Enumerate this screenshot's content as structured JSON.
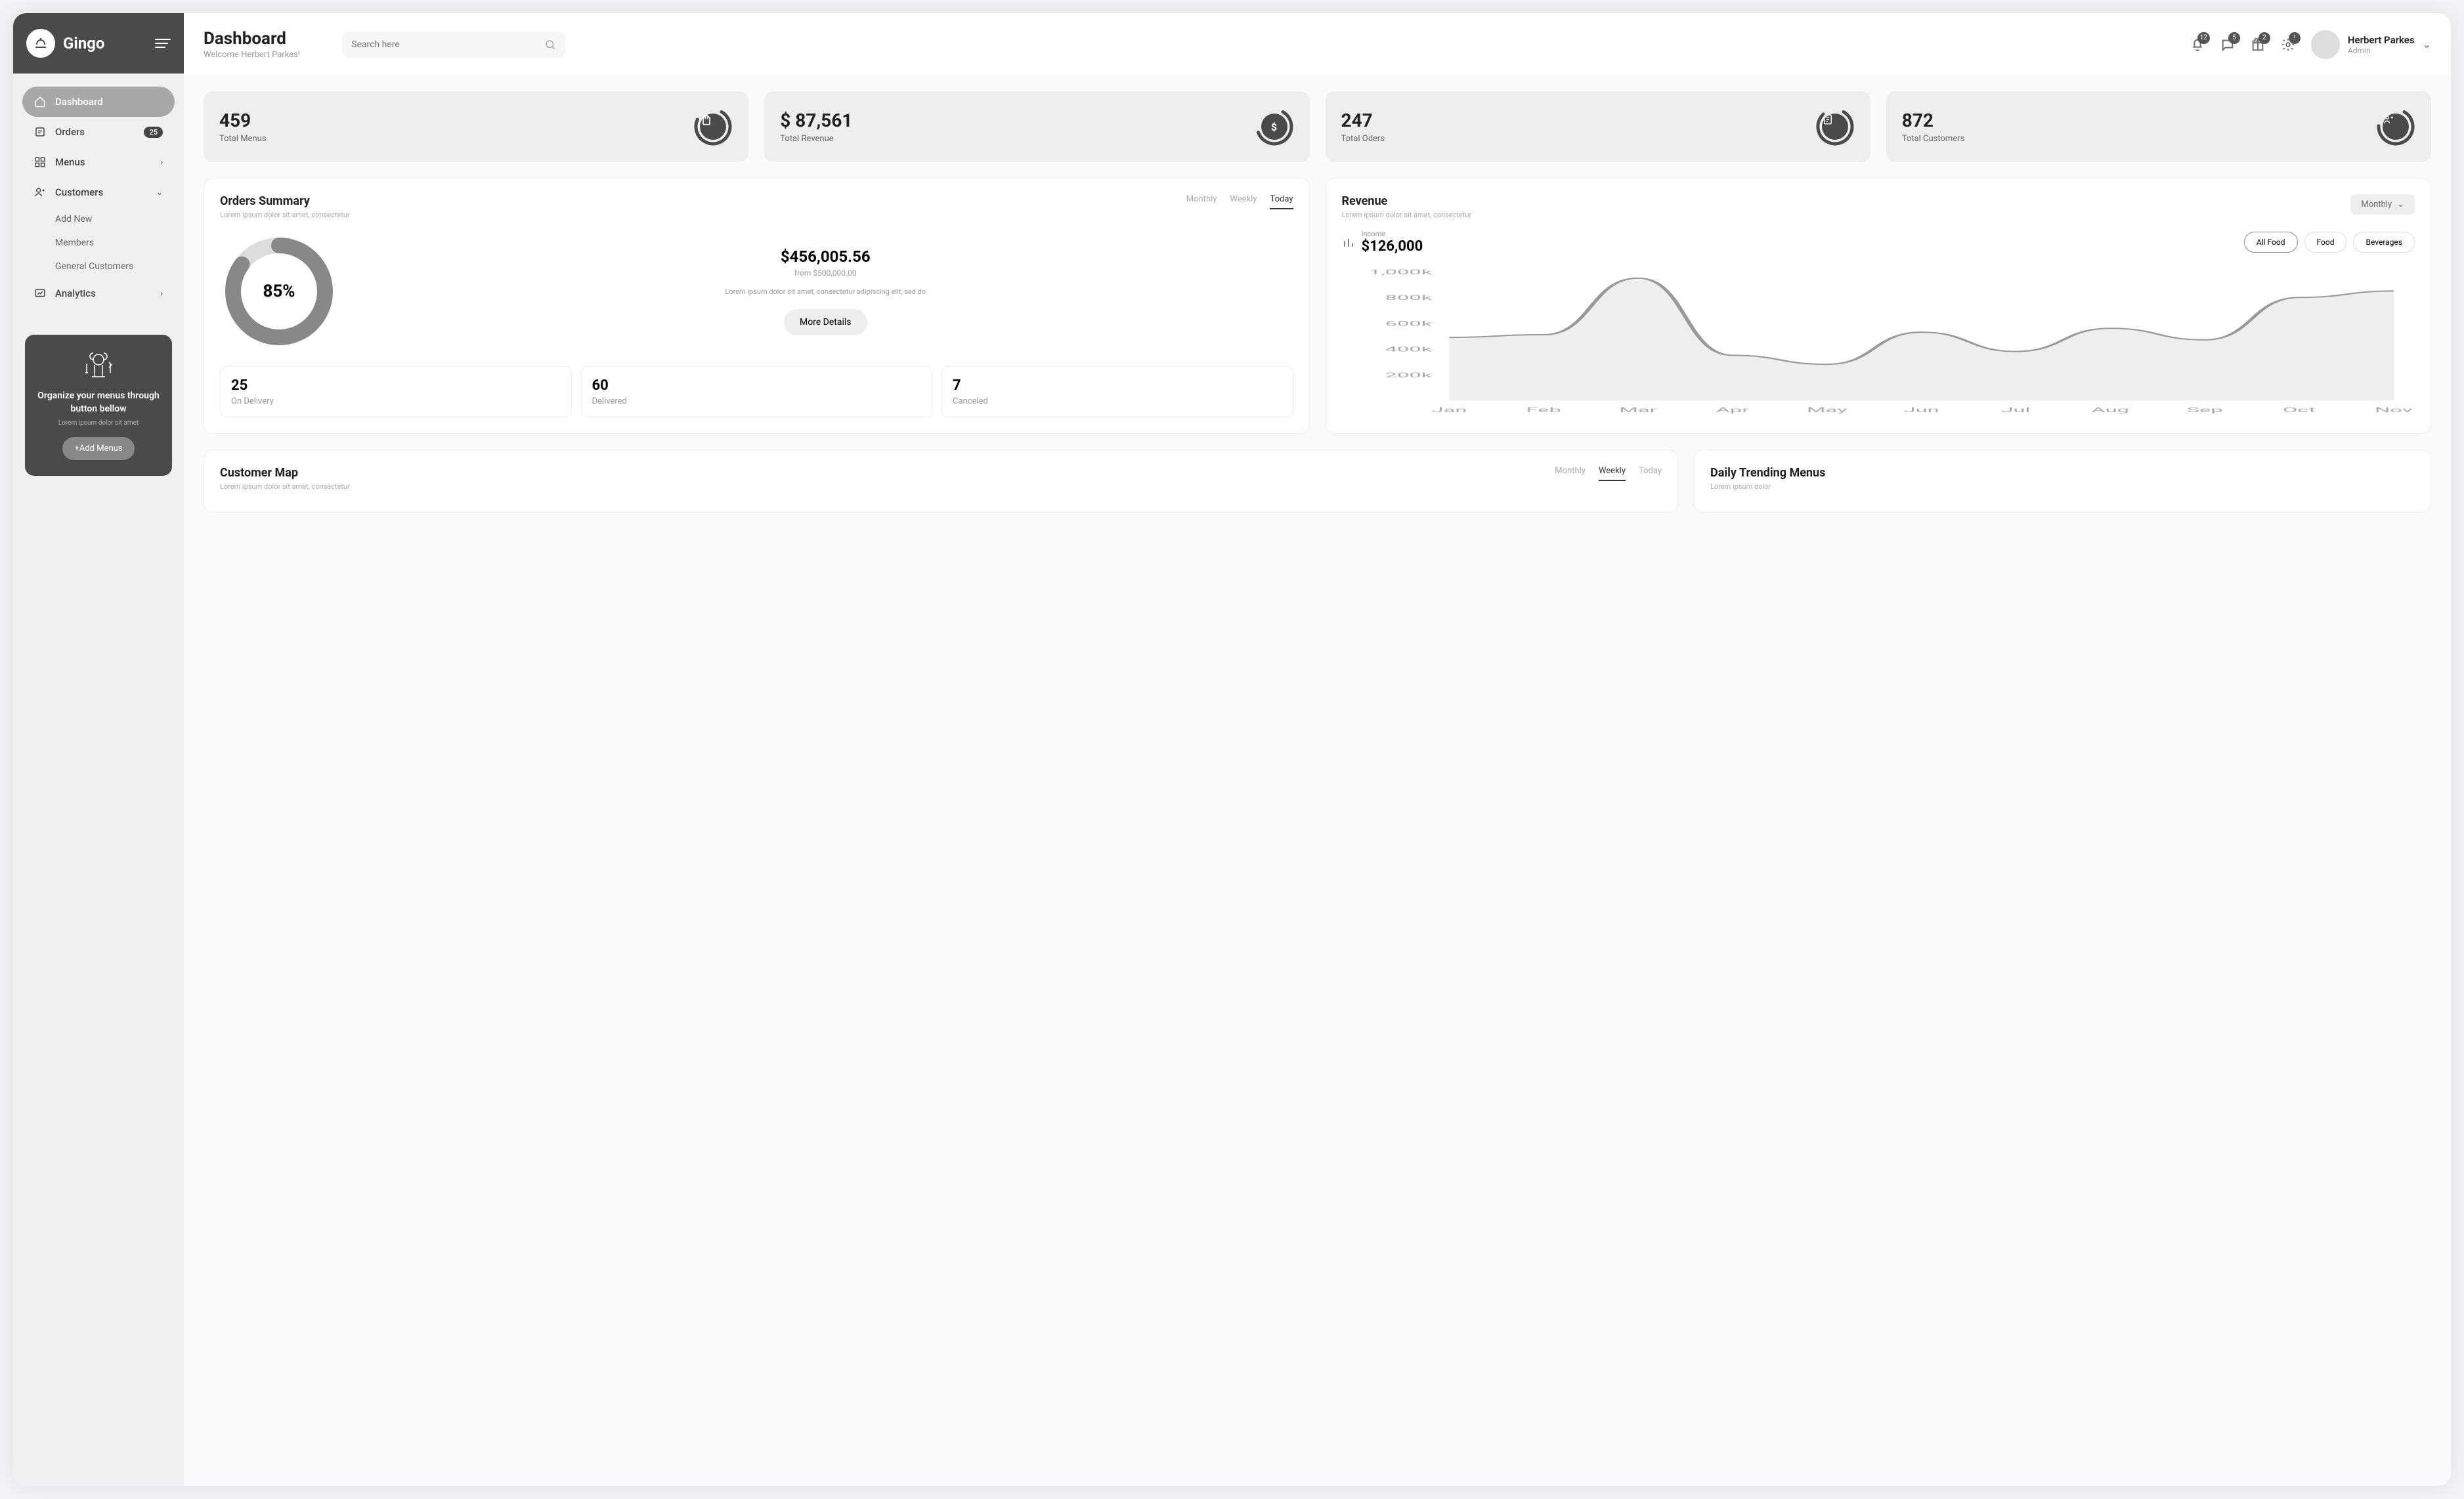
{
  "brand": {
    "name": "Gingo"
  },
  "page": {
    "title": "Dashboard",
    "welcome": "Welcome Herbert Parkes!"
  },
  "search": {
    "placeholder": "Search here"
  },
  "notifications": {
    "bell": "12",
    "chat": "5",
    "gift": "2",
    "settings": "!"
  },
  "user": {
    "name": "Herbert Parkes",
    "role": "Admin"
  },
  "sidebar": {
    "items": [
      {
        "label": "Dashboard"
      },
      {
        "label": "Orders",
        "badge": "25"
      },
      {
        "label": "Menus"
      },
      {
        "label": "Customers"
      },
      {
        "label": "Analytics"
      }
    ],
    "customers_sub": [
      {
        "label": "Add New"
      },
      {
        "label": "Members"
      },
      {
        "label": "General Customers"
      }
    ]
  },
  "promo": {
    "title": "Organize your menus through button bellow",
    "sub": "Lorem ipsum dolor sit amet",
    "btn": "+Add Menus"
  },
  "stats": [
    {
      "value": "459",
      "label": "Total Menus"
    },
    {
      "value": "$ 87,561",
      "label": "Total Revenue"
    },
    {
      "value": "247",
      "label": "Total Oders"
    },
    {
      "value": "872",
      "label": "Total Customers"
    }
  ],
  "orders": {
    "title": "Orders Summary",
    "sub": "Lorem ipsum dolor sit amet, consectetur",
    "tabs": [
      "Monthly",
      "Weekly",
      "Today"
    ],
    "active_tab": 2,
    "percent": "85%",
    "amount": "$456,005.56",
    "from": "from $500,000.00",
    "desc": "Lorem ipsum dolor sit amet, consectetur adipiscing elit, sed do",
    "more_btn": "More Details",
    "sub_stats": [
      {
        "value": "25",
        "label": "On Delivery"
      },
      {
        "value": "60",
        "label": "Delivered"
      },
      {
        "value": "7",
        "label": "Canceled"
      }
    ]
  },
  "revenue": {
    "title": "Revenue",
    "sub": "Lorem ipsum dolor sit amet, consectetur",
    "dropdown": "Monthly",
    "income_label": "Income",
    "income_value": "$126,000",
    "pills": [
      "All Food",
      "Food",
      "Beverages"
    ],
    "active_pill": 0
  },
  "customer_map": {
    "title": "Customer Map",
    "sub": "Lorem ipsum dolor sit amet, consectetur",
    "tabs": [
      "Monthly",
      "Weekly",
      "Today"
    ],
    "active_tab": 1
  },
  "trending": {
    "title": "Daily Trending Menus",
    "sub": "Lorem ipsum dolor"
  },
  "chart_data": {
    "type": "area",
    "title": "Revenue",
    "xlabel": "",
    "ylabel": "",
    "ylim": [
      0,
      1000
    ],
    "y_ticks": [
      "200k",
      "400k",
      "600k",
      "800k",
      "1,000k"
    ],
    "categories": [
      "Jan",
      "Feb",
      "Mar",
      "Apr",
      "May",
      "Jun",
      "Jul",
      "Aug",
      "Sep",
      "Oct",
      "Nov"
    ],
    "series": [
      {
        "name": "All Food",
        "values": [
          490,
          510,
          950,
          350,
          280,
          530,
          380,
          560,
          470,
          800,
          850
        ]
      }
    ]
  }
}
